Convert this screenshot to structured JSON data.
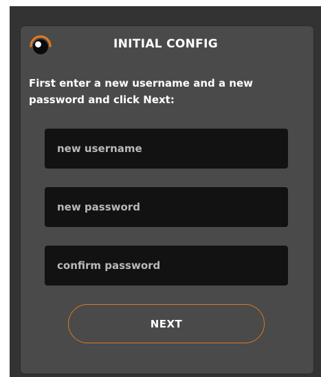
{
  "dialog": {
    "title": "INITIAL CONFIG",
    "logo_icon": "eye-logo-icon",
    "instructions": "First enter a new username and a new password and click Next:"
  },
  "form": {
    "username_placeholder": "new username",
    "username_value": "",
    "password_placeholder": "new password",
    "password_value": "",
    "confirm_placeholder": "confirm password",
    "confirm_value": "",
    "next_label": "NEXT"
  },
  "colors": {
    "frame_background": "#333333",
    "dialog_background": "#4a4a4a",
    "input_background": "#121212",
    "accent": "#e07a1f",
    "text": "#ffffff"
  }
}
